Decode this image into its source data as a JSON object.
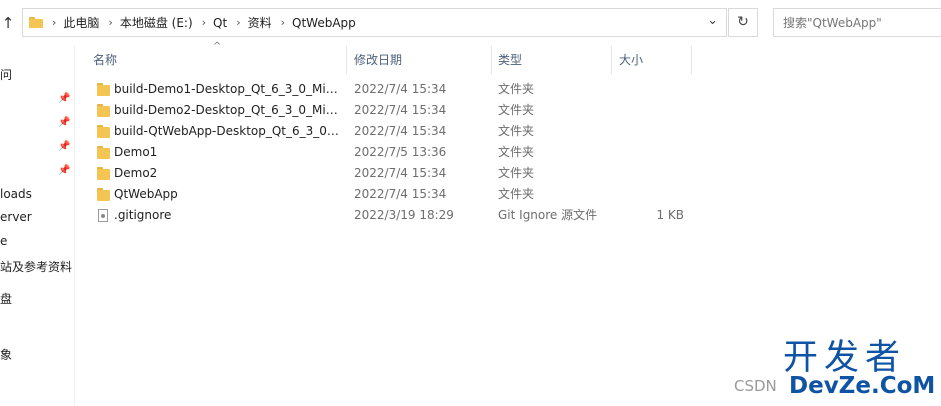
{
  "address_bar": {
    "crumbs": [
      "此电脑",
      "本地磁盘 (E:)",
      "Qt",
      "资料",
      "QtWebApp"
    ],
    "search_placeholder": "搜索\"QtWebApp\""
  },
  "nav_pane": {
    "items": [
      "问",
      "loads",
      "erver",
      "e",
      "站及参考资料",
      "盘",
      "象"
    ]
  },
  "columns": {
    "name": "名称",
    "date": "修改日期",
    "type": "类型",
    "size": "大小"
  },
  "files": [
    {
      "name": "build-Demo1-Desktop_Qt_6_3_0_Min...",
      "date": "2022/7/4 15:34",
      "type": "文件夹",
      "size": "",
      "kind": "folder"
    },
    {
      "name": "build-Demo2-Desktop_Qt_6_3_0_Min...",
      "date": "2022/7/4 15:34",
      "type": "文件夹",
      "size": "",
      "kind": "folder"
    },
    {
      "name": "build-QtWebApp-Desktop_Qt_6_3_0_...",
      "date": "2022/7/4 15:34",
      "type": "文件夹",
      "size": "",
      "kind": "folder"
    },
    {
      "name": "Demo1",
      "date": "2022/7/5 13:36",
      "type": "文件夹",
      "size": "",
      "kind": "folder"
    },
    {
      "name": "Demo2",
      "date": "2022/7/4 15:34",
      "type": "文件夹",
      "size": "",
      "kind": "folder"
    },
    {
      "name": "QtWebApp",
      "date": "2022/7/4 15:34",
      "type": "文件夹",
      "size": "",
      "kind": "folder"
    },
    {
      "name": ".gitignore",
      "date": "2022/3/19 18:29",
      "type": "Git Ignore 源文件",
      "size": "1 KB",
      "kind": "file"
    }
  ],
  "watermark": {
    "brand": "开发者",
    "sub": "DevZe.CoM",
    "csdn": "CSDN"
  },
  "colors": {
    "folder": "#f4c553",
    "header_text": "#4c607a",
    "watermark": "#0e53a4"
  }
}
